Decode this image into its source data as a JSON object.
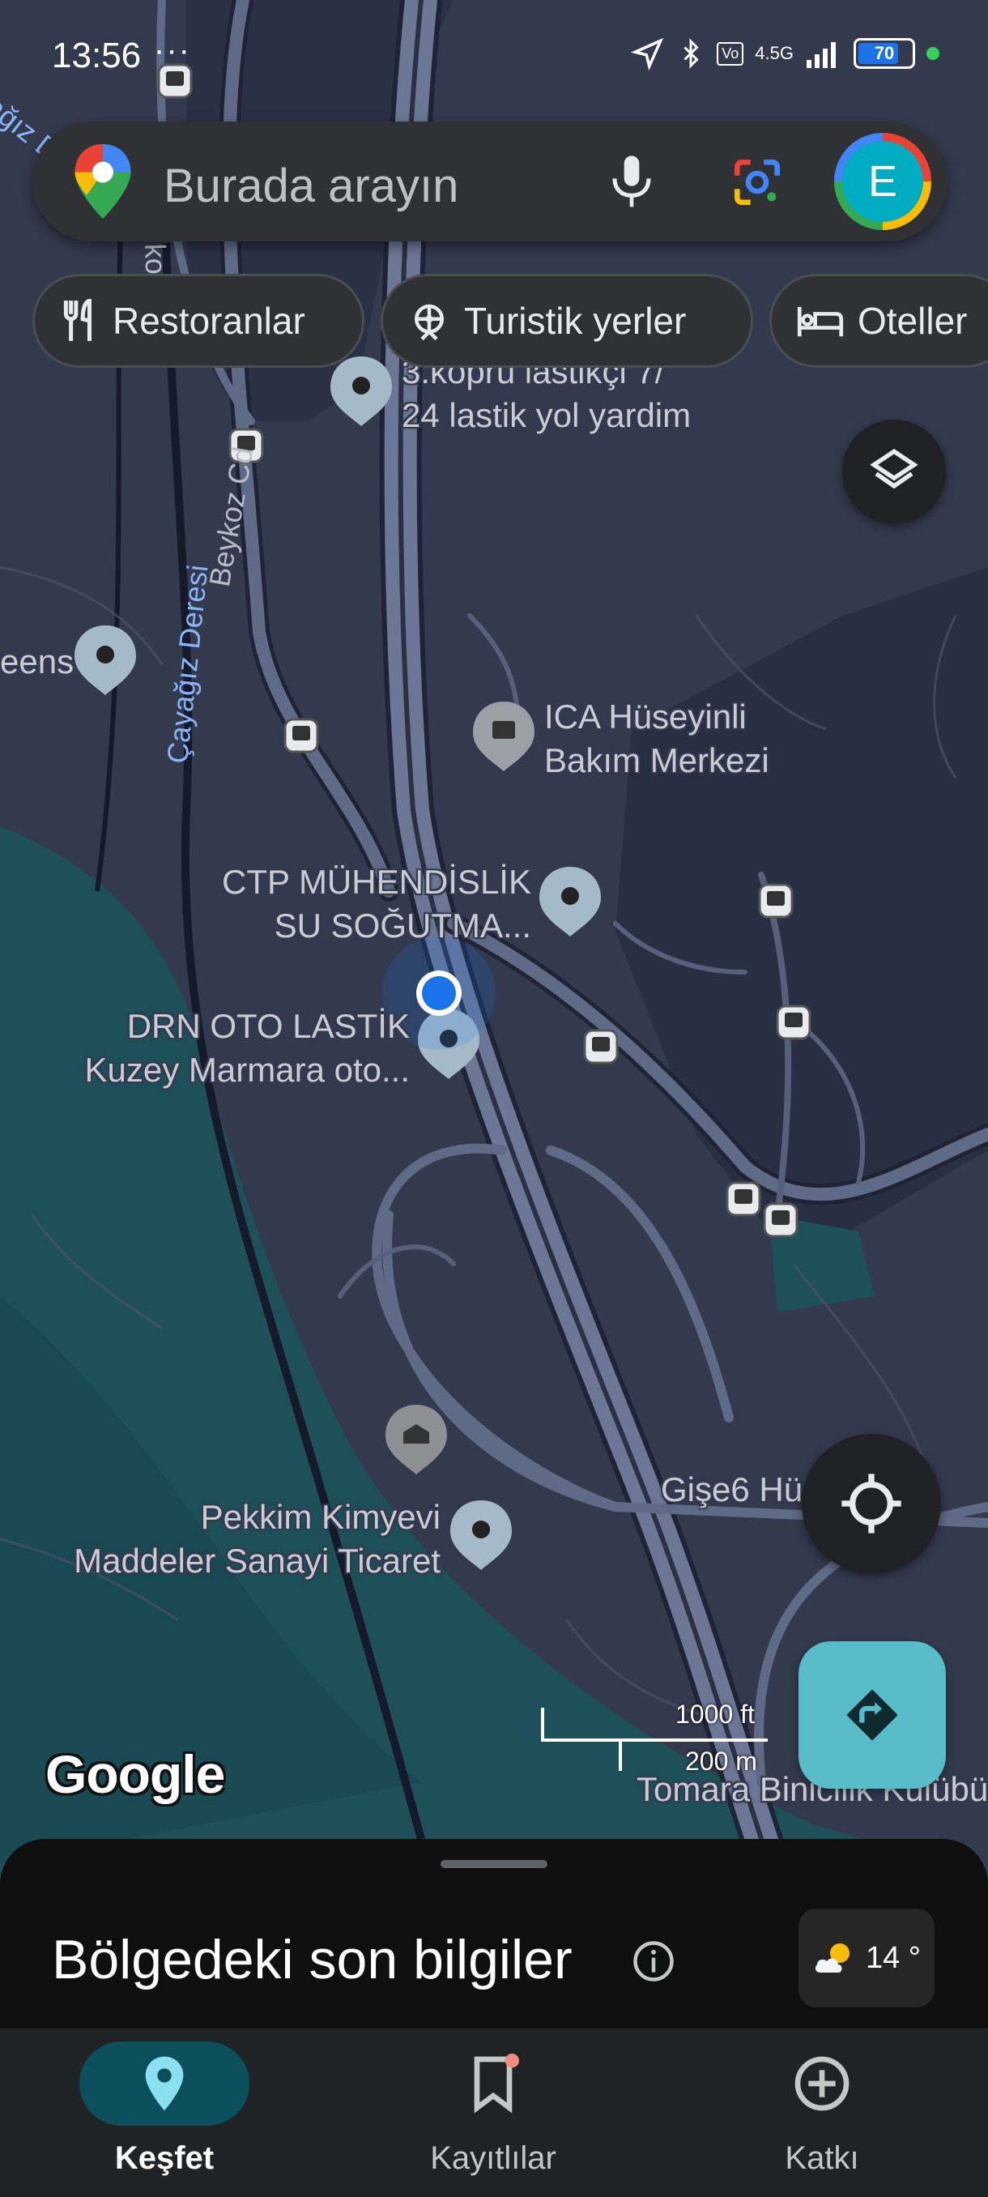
{
  "status_bar": {
    "time": "13:56",
    "overflow": "···",
    "network": "4.5G",
    "battery_level": 70,
    "battery_text": "70"
  },
  "search": {
    "placeholder": "Burada arayın",
    "avatar_letter": "E"
  },
  "chips": [
    {
      "label": "Restoranlar",
      "icon": "fork-knife-icon"
    },
    {
      "label": "Turistik yerler",
      "icon": "ferris-wheel-icon"
    },
    {
      "label": "Oteller",
      "icon": "bed-icon"
    }
  ],
  "map": {
    "places": {
      "lastikci": {
        "line1": "3.köprü lastikçi 7/",
        "line2": "24 lastik yol yardim"
      },
      "greens": {
        "line1": "eens"
      },
      "ica": {
        "line1": "ICA Hüseyinli",
        "line2": "Bakım Merkezi"
      },
      "ctp": {
        "line1": "CTP MÜHENDİSLİK",
        "line2": "SU SOĞUTMA..."
      },
      "drn": {
        "line1": "DRN OTO LASTİK",
        "line2": "Kuzey Marmara oto..."
      },
      "pekkim": {
        "line1": "Pekkim Kimyevi",
        "line2": "Maddeler Sanayi Ticaret"
      },
      "gise": {
        "line1": "Gişe6 Hü..."
      },
      "tomara": {
        "line1": "Tomara Binicilik Kulübü"
      }
    },
    "roads": {
      "beykoz": "Beykoz Cd",
      "cayagiz": "Çayağız Deresi",
      "top_left": "ağız D",
      "top_road": "ko"
    },
    "scale": {
      "imperial": "1000 ft",
      "metric": "200 m"
    },
    "attribution": "Google"
  },
  "sheet": {
    "title": "Bölgedeki son bilgiler",
    "weather_temp": "14 °"
  },
  "nav": [
    {
      "label": "Keşfet",
      "icon": "location-pin-icon",
      "active": true
    },
    {
      "label": "Kayıtlılar",
      "icon": "bookmark-icon",
      "active": false
    },
    {
      "label": "Katkı",
      "icon": "add-circle-icon",
      "active": false
    }
  ],
  "colors": {
    "land": "#343a4e",
    "water": "#1d5059",
    "road": "#6b7794",
    "accent": "#57bbc8",
    "location": "#1a73e8"
  }
}
